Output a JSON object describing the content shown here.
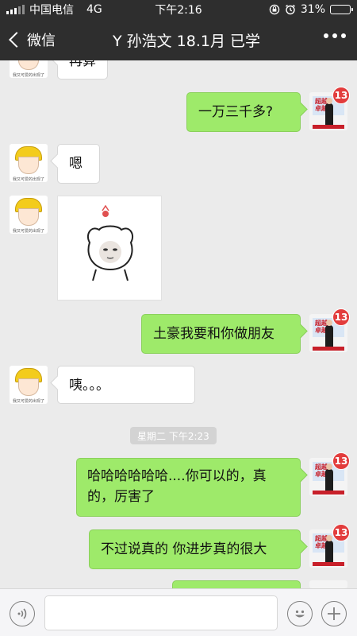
{
  "status_bar": {
    "carrier": "中国电信",
    "network": "4G",
    "time": "下午2:16",
    "battery_percent": "31%",
    "battery_level": 0.31
  },
  "nav": {
    "back_label": "微信",
    "title": "Y  孙浩文 18.1月 已学"
  },
  "chat": {
    "avatar_caption": "我又可爱的出现了",
    "avatar_poster_text": "超越\n卓越",
    "badge_count": "13",
    "partial_bubble": "再算",
    "messages": [
      {
        "side": "right",
        "type": "text",
        "text": "一万三千多?"
      },
      {
        "side": "left",
        "type": "text",
        "text": "嗯"
      },
      {
        "side": "left",
        "type": "sticker"
      },
      {
        "side": "right",
        "type": "text",
        "text": "土豪我要和你做朋友"
      },
      {
        "side": "left",
        "type": "text",
        "text": "咦。。。"
      },
      {
        "type": "timestamp",
        "text": "星期二 下午2:23"
      },
      {
        "side": "right",
        "type": "text",
        "text": "哈哈哈哈哈哈....你可以的，真的，厉害了"
      },
      {
        "side": "right",
        "type": "text",
        "text": "不过说真的 你进步真的很大"
      }
    ]
  },
  "input_bar": {
    "value": "",
    "voice_icon": "voice-icon",
    "emoji_icon": "emoji-icon",
    "plus_icon": "plus-icon"
  },
  "colors": {
    "nav_bg": "#2e2e2e",
    "chat_bg": "#ebebeb",
    "bubble_green": "#9eea6a",
    "badge_red": "#e23c3c"
  }
}
